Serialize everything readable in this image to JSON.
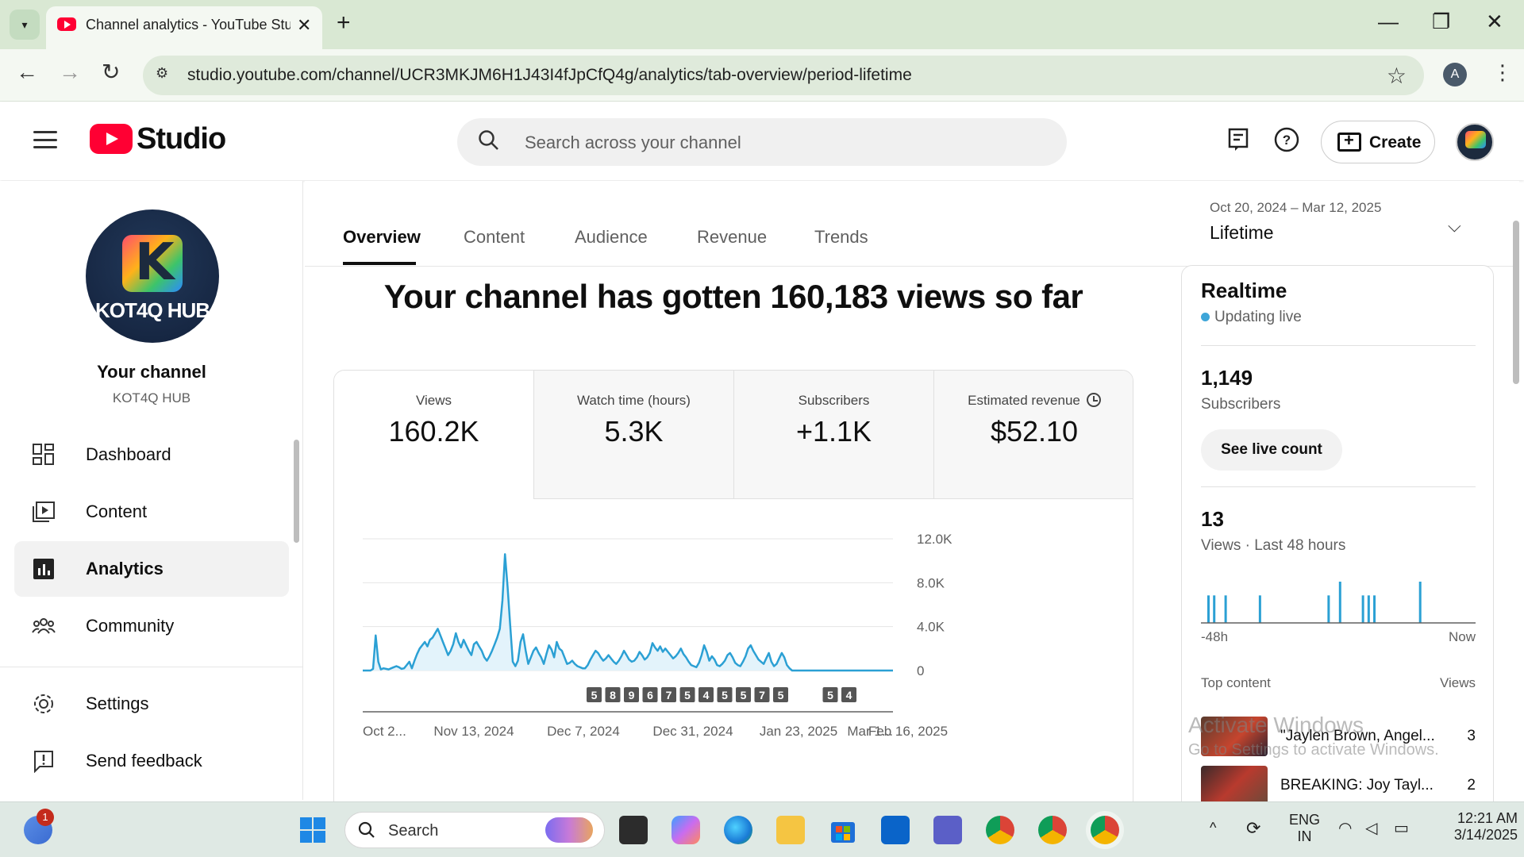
{
  "browser": {
    "tab_title": "Channel analytics - YouTube Studio",
    "url": "studio.youtube.com/channel/UCR3MKJM6H1J43I4fJpCfQ4g/analytics/tab-overview/period-lifetime",
    "profile_initial": "A"
  },
  "header": {
    "logo_text": "Studio",
    "search_placeholder": "Search across your channel",
    "create_label": "Create"
  },
  "sidebar": {
    "avatar_text": "KOT4Q HUB",
    "avatar_letter": "K",
    "your_channel": "Your channel",
    "channel_name": "KOT4Q HUB",
    "items": [
      {
        "label": "Dashboard",
        "icon": "dashboard-icon"
      },
      {
        "label": "Content",
        "icon": "content-icon"
      },
      {
        "label": "Analytics",
        "icon": "analytics-icon",
        "active": true
      },
      {
        "label": "Community",
        "icon": "community-icon"
      },
      {
        "label": "Settings",
        "icon": "gear-icon"
      },
      {
        "label": "Send feedback",
        "icon": "feedback-icon"
      }
    ]
  },
  "tabs": [
    "Overview",
    "Content",
    "Audience",
    "Revenue",
    "Trends"
  ],
  "period": {
    "dates": "Oct 20, 2024 – Mar 12, 2025",
    "label": "Lifetime"
  },
  "headline": "Your channel has gotten 160,183 views so far",
  "metrics": [
    {
      "label": "Views",
      "value": "160.2K"
    },
    {
      "label": "Watch time (hours)",
      "value": "5.3K"
    },
    {
      "label": "Subscribers",
      "value": "+1.1K"
    },
    {
      "label": "Estimated revenue",
      "value": "$52.10"
    }
  ],
  "chart_data": {
    "type": "area",
    "title": "",
    "ylim": [
      0,
      12000
    ],
    "y_ticks": [
      "0",
      "4.0K",
      "8.0K",
      "12.0K"
    ],
    "x_tick_labels": [
      "Oct 2...",
      "Nov 13, 2024",
      "Dec 7, 2024",
      "Dec 31, 2024",
      "Jan 23, 2025",
      "Feb 16, 2025",
      "Mar 1..."
    ],
    "series": [
      {
        "values": [
          0,
          0,
          0,
          0,
          150,
          3200,
          800,
          100,
          200,
          150,
          100,
          200,
          300,
          400,
          300,
          150,
          200,
          500,
          800,
          200,
          900,
          1500,
          2000,
          2300,
          2600,
          2200,
          2800,
          3000,
          3400,
          3800,
          3200,
          2600,
          2000,
          1400,
          1800,
          2400,
          3400,
          2600,
          2100,
          2800,
          2300,
          1800,
          1400,
          2400,
          2600,
          2200,
          1800,
          1200,
          900,
          1300,
          1800,
          2400,
          3000,
          3800,
          6400,
          10600,
          7600,
          4200,
          800,
          400,
          900,
          2600,
          3300,
          1800,
          600,
          1200,
          1800,
          2100,
          1600,
          1200,
          600,
          1500,
          2300,
          1900,
          1200,
          2600,
          2000,
          1800,
          1200,
          600,
          700,
          900,
          600,
          400,
          300,
          200,
          200,
          500,
          1000,
          1400,
          1800,
          1600,
          1200,
          900,
          1100,
          1400,
          1100,
          800,
          600,
          900,
          1300,
          1800,
          1400,
          1000,
          800,
          900,
          1200,
          1700,
          1400,
          1000,
          1200,
          1600,
          2500,
          2100,
          1800,
          2200,
          1700,
          2000,
          1700,
          1400,
          1100,
          1300,
          1600,
          2000,
          1500,
          1200,
          800,
          500,
          400,
          300,
          700,
          1400,
          2300,
          1700,
          900,
          1300,
          1000,
          500,
          400,
          600,
          900,
          1400,
          1600,
          1200,
          700,
          500,
          400,
          800,
          1300,
          2000,
          2300,
          1800,
          1400,
          1000,
          800,
          600,
          1100,
          1600,
          800,
          400,
          600,
          1100,
          1600,
          1200,
          500,
          200,
          0,
          0,
          0,
          0,
          0,
          0,
          0,
          0,
          0,
          0,
          0,
          0,
          0,
          0,
          0,
          0,
          0,
          0,
          0,
          0,
          0,
          0,
          0,
          0,
          0,
          0,
          0,
          0,
          0,
          0,
          0,
          0,
          0,
          0,
          0,
          0,
          0,
          0,
          0,
          0
        ]
      }
    ],
    "markers": [
      "5",
      "8",
      "9",
      "6",
      "7",
      "5",
      "4",
      "5",
      "5",
      "7",
      "5",
      "5",
      "4"
    ],
    "grid": true
  },
  "realtime": {
    "title": "Realtime",
    "status": "Updating live",
    "subscribers_value": "1,149",
    "subscribers_label": "Subscribers",
    "live_button": "See live count",
    "views_value": "13",
    "views_label": "Views · Last 48 hours",
    "axis_left": "-48h",
    "axis_right": "Now",
    "bars": [
      2,
      2,
      0,
      2,
      0,
      0,
      0,
      0,
      0,
      2,
      0,
      0,
      0,
      0,
      0,
      0,
      0,
      0,
      0,
      0,
      0,
      2,
      0,
      3,
      0,
      0,
      0,
      2,
      2,
      2,
      0,
      0,
      0,
      0,
      0,
      0,
      0,
      3,
      0,
      0,
      0,
      0,
      0,
      0,
      0,
      0,
      0,
      0
    ],
    "top_content_label": "Top content",
    "top_content_views_label": "Views",
    "top_content": [
      {
        "title": "\"Jaylen Brown, Angel...",
        "views": "3"
      },
      {
        "title": "BREAKING: Joy Tayl...",
        "views": "2"
      }
    ]
  },
  "watermark": {
    "title": "Activate Windows",
    "subtitle": "Go to Settings to activate Windows."
  },
  "taskbar": {
    "search_label": "Search",
    "notification_count": "1",
    "lang_line1": "ENG",
    "lang_line2": "IN",
    "time": "12:21 AM",
    "date": "3/14/2025"
  }
}
